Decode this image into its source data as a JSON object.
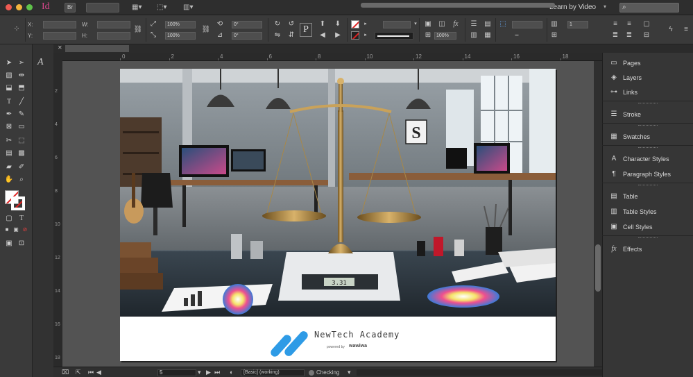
{
  "app": {
    "logo": "Id",
    "bridge_button": "Br",
    "zoom_value": "",
    "workspace_label": "Learn by Video",
    "search_placeholder": ""
  },
  "control_panel": {
    "x_label": "X:",
    "y_label": "Y:",
    "w_label": "W:",
    "h_label": "H:",
    "x_value": "",
    "y_value": "",
    "w_value": "",
    "h_value": "",
    "scale_x": "100%",
    "scale_y": "100%",
    "rotate": "0°",
    "shear": "0°",
    "stroke_weight": "",
    "opacity": "100%",
    "columns": "1",
    "paragraph_icon_letter": "P"
  },
  "document": {
    "ruler_labels": [
      "0",
      "2",
      "4",
      "6",
      "8",
      "10",
      "12",
      "14",
      "16",
      "18"
    ],
    "vertical_ruler_labels": [
      "2",
      "4",
      "6",
      "8",
      "10",
      "12",
      "14",
      "16",
      "18"
    ],
    "brand_name": "NewTech Academy",
    "brand_powered_by": "powered by",
    "brand_partner": "wawiwa",
    "scale_display": "3.31",
    "scene_letter": "S",
    "colors": {
      "brand_blue": "#2e9be6",
      "page_bg": "#ffffff",
      "pasteboard": "#535353"
    }
  },
  "footer": {
    "page_number": "5",
    "style_label": "[Basic] (working)",
    "preflight_label": "Checking"
  },
  "right_panels": [
    {
      "label": "Pages",
      "icon": "pages-icon"
    },
    {
      "label": "Layers",
      "icon": "layers-icon"
    },
    {
      "label": "Links",
      "icon": "links-icon"
    },
    {
      "label": "Stroke",
      "icon": "stroke-icon"
    },
    {
      "label": "Swatches",
      "icon": "swatches-icon"
    },
    {
      "label": "Character Styles",
      "icon": "character-styles-icon"
    },
    {
      "label": "Paragraph Styles",
      "icon": "paragraph-styles-icon"
    },
    {
      "label": "Table",
      "icon": "table-icon"
    },
    {
      "label": "Table Styles",
      "icon": "table-styles-icon"
    },
    {
      "label": "Cell Styles",
      "icon": "cell-styles-icon"
    },
    {
      "label": "Effects",
      "icon": "effects-icon"
    }
  ]
}
